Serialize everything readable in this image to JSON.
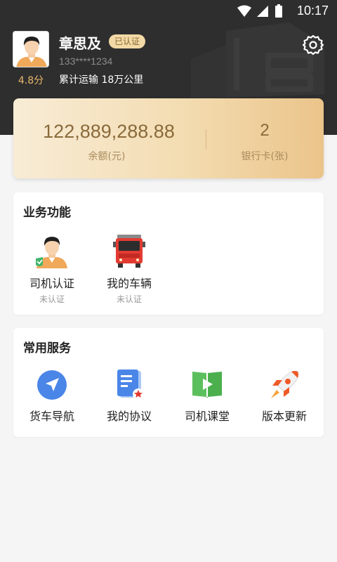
{
  "status_bar": {
    "time": "10:17"
  },
  "profile": {
    "name": "章思及",
    "badge": "已认证",
    "phone": "133****1234",
    "rating": "4.8分",
    "mileage": "累计运输 18万公里"
  },
  "wallet": {
    "balance": "122,889,288.88",
    "balance_label": "余额(元)",
    "cards": "2",
    "cards_label": "银行卡(张)"
  },
  "business": {
    "title": "业务功能",
    "items": [
      {
        "label": "司机认证",
        "sub": "未认证",
        "icon": "driver-avatar-icon"
      },
      {
        "label": "我的车辆",
        "sub": "未认证",
        "icon": "truck-icon"
      }
    ]
  },
  "services": {
    "title": "常用服务",
    "items": [
      {
        "label": "货车导航",
        "icon": "navigation-icon"
      },
      {
        "label": "我的协议",
        "icon": "document-icon"
      },
      {
        "label": "司机课堂",
        "icon": "book-play-icon"
      },
      {
        "label": "版本更新",
        "icon": "rocket-icon"
      }
    ]
  },
  "colors": {
    "header_bg": "#2e2e2e",
    "gold": "#e8b76b",
    "card_gradient_start": "#f8ecd6",
    "card_gradient_end": "#ebc48a"
  }
}
